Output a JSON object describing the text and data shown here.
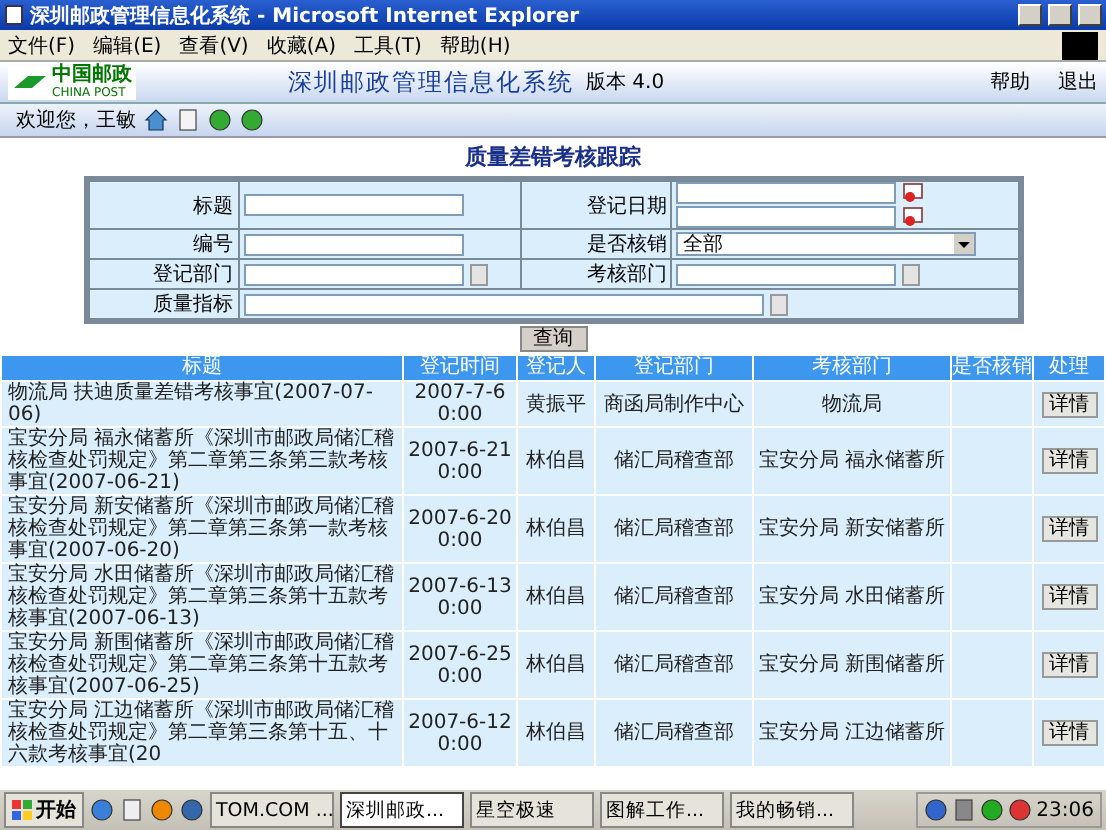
{
  "window": {
    "title": "深圳邮政管理信息化系统 - Microsoft Internet Explorer"
  },
  "menu": [
    "文件(F)",
    "编辑(E)",
    "查看(V)",
    "收藏(A)",
    "工具(T)",
    "帮助(H)"
  ],
  "header": {
    "logo_text": "中国邮政",
    "logo_subtext": "CHINA POST",
    "system_title": "深圳邮政管理信息化系统",
    "version": "版本 4.0",
    "links": [
      "帮助",
      "退出"
    ]
  },
  "toolbar": {
    "welcome": "欢迎您，王敏"
  },
  "page_title": "质量差错考核跟踪",
  "form": {
    "rows": [
      [
        {
          "label": "标题",
          "kind": "text"
        },
        {
          "label": "登记日期",
          "kind": "date_range"
        }
      ],
      [
        {
          "label": "编号",
          "kind": "text"
        },
        {
          "label": "是否核销",
          "kind": "select",
          "value": "全部"
        }
      ],
      [
        {
          "label": "登记部门",
          "kind": "picker"
        },
        {
          "label": "考核部门",
          "kind": "picker"
        }
      ],
      [
        {
          "label": "质量指标",
          "kind": "wide_picker"
        }
      ]
    ]
  },
  "query_button": "查询",
  "table": {
    "columns": [
      "标题",
      "登记时间",
      "登记人",
      "登记部门",
      "考核部门",
      "是否核销",
      "处理"
    ],
    "rows": [
      {
        "title": "物流局 扶迪质量差错考核事宜(2007-07-06)",
        "time": "2007-7-6 0:00",
        "person": "黄振平",
        "reg_dept": "商函局制作中心",
        "check_dept": "物流局",
        "action": "详情"
      },
      {
        "title": "宝安分局 福永储蓄所《深圳市邮政局储汇稽核检查处罚规定》第二章第三条第三款考核事宜(2007-06-21)",
        "time": "2007-6-21 0:00",
        "person": "林伯昌",
        "reg_dept": "储汇局稽查部",
        "check_dept": "宝安分局 福永储蓄所",
        "action": "详情"
      },
      {
        "title": "宝安分局 新安储蓄所《深圳市邮政局储汇稽核检查处罚规定》第二章第三条第一款考核事宜(2007-06-20)",
        "time": "2007-6-20 0:00",
        "person": "林伯昌",
        "reg_dept": "储汇局稽查部",
        "check_dept": "宝安分局 新安储蓄所",
        "action": "详情"
      },
      {
        "title": "宝安分局 水田储蓄所《深圳市邮政局储汇稽核检查处罚规定》第二章第三条第十五款考核事宜(2007-06-13)",
        "time": "2007-6-13 0:00",
        "person": "林伯昌",
        "reg_dept": "储汇局稽查部",
        "check_dept": "宝安分局 水田储蓄所",
        "action": "详情"
      },
      {
        "title": "宝安分局 新围储蓄所《深圳市邮政局储汇稽核检查处罚规定》第二章第三条第十五款考核事宜(2007-06-25)",
        "time": "2007-6-25 0:00",
        "person": "林伯昌",
        "reg_dept": "储汇局稽查部",
        "check_dept": "宝安分局 新围储蓄所",
        "action": "详情"
      },
      {
        "title": "宝安分局 江边储蓄所《深圳市邮政局储汇稽核检查处罚规定》第二章第三条第十五、十六款考核事宜(20",
        "time": "2007-6-12 0:00",
        "person": "林伯昌",
        "reg_dept": "储汇局稽查部",
        "check_dept": "宝安分局 江边储蓄所",
        "action": "详情"
      }
    ]
  },
  "taskbar": {
    "start": "开始",
    "tasks": [
      {
        "label": "TOM.COM ...",
        "selected": false
      },
      {
        "label": "深圳邮政...",
        "selected": true
      },
      {
        "label": "星空极速",
        "selected": false
      },
      {
        "label": "图解工作...",
        "selected": false
      },
      {
        "label": "我的畅销...",
        "selected": false
      }
    ],
    "clock": "23:06"
  }
}
